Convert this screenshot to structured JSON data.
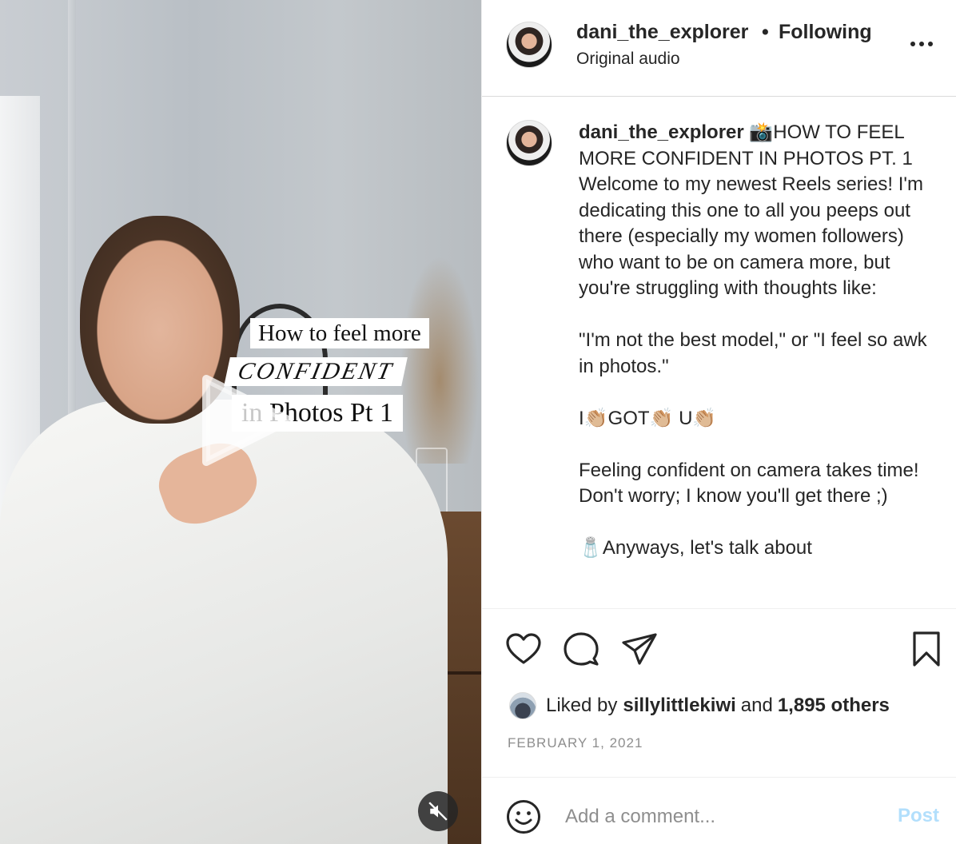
{
  "video": {
    "overlay_line1": "How to feel more",
    "overlay_line2": "CONFIDENT",
    "overlay_line3": "in Photos  Pt 1",
    "play_icon": "play-icon",
    "mute_icon": "speaker-muted-icon"
  },
  "header": {
    "username": "dani_the_explorer",
    "separator": "•",
    "follow_status": "Following",
    "audio": "Original audio",
    "more_icon": "more-options-icon"
  },
  "caption": {
    "username": "dani_the_explorer",
    "paragraphs": [
      "📸HOW TO FEEL MORE CONFIDENT IN PHOTOS PT. 1 Welcome to my newest Reels series! I'm dedicating this one to all you peeps out there (especially my women followers) who want to be on camera more, but you're struggling with thoughts like:",
      "\"I'm not the best model,\" or \"I feel so awk in photos.\"",
      "I👏🏼GOT👏🏼 U👏🏼",
      "Feeling confident on camera takes time! Don't worry; I know you'll get there ;)",
      "🧂Anyways, let's talk about"
    ]
  },
  "actions": {
    "like_icon": "heart-icon",
    "comment_icon": "comment-bubble-icon",
    "share_icon": "paper-plane-icon",
    "save_icon": "bookmark-icon"
  },
  "likes": {
    "prefix": "Liked by",
    "user": "sillylittlekiwi",
    "conj": "and",
    "others": "1,895 others"
  },
  "date": "FEBRUARY 1, 2021",
  "comment": {
    "placeholder": "Add a comment...",
    "post_label": "Post",
    "emoji_icon": "smiley-face-icon"
  },
  "colors": {
    "text": "#262626",
    "muted": "#8e8e8e",
    "post_disabled": "#b2dffc",
    "divider": "#dbdbdb"
  }
}
